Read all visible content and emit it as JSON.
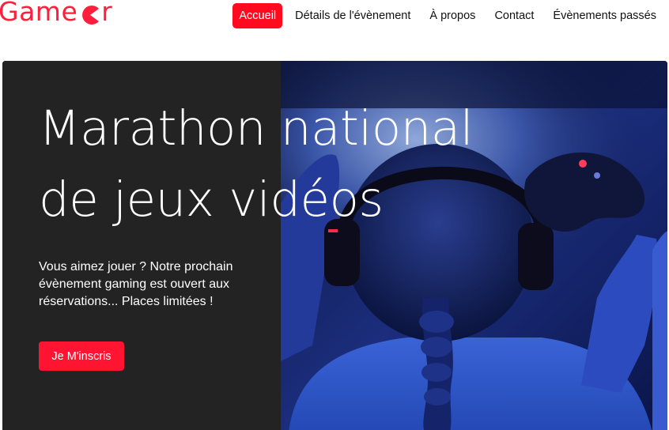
{
  "brand": {
    "name_prefix": "Game",
    "name_suffix": "r",
    "icon": "pacman-icon",
    "color": "#ff1f3d"
  },
  "nav": {
    "items": [
      {
        "label": "Accueil",
        "active": true
      },
      {
        "label": "Détails de l'évènement"
      },
      {
        "label": "À propos"
      },
      {
        "label": "Contact"
      },
      {
        "label": "Évènements passés"
      }
    ],
    "active_color": "#ff0a1f"
  },
  "hero": {
    "title_line1": "Marathon national",
    "title_line2": "de jeux vidéos",
    "description": "Vous aimez jouer ? Notre prochain évènement gaming est ouvert aux réservations... Places limitées !",
    "cta_label": "Je M'inscris",
    "cta_color": "#ff1431",
    "image": "gamer-with-headphones-and-controller-photo"
  }
}
